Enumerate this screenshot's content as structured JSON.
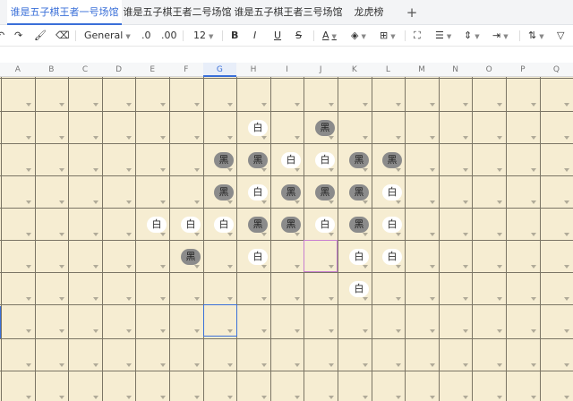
{
  "tabs": [
    {
      "label": "谁是五子棋王者一号场馆",
      "active": true
    },
    {
      "label": "谁是五子棋王者二号场馆",
      "active": false
    },
    {
      "label": "谁是五子棋王者三号场馆",
      "active": false
    },
    {
      "label": "龙虎榜",
      "active": false
    }
  ],
  "add_tab": "+",
  "toolbar": {
    "number_format": "General",
    "decrease_decimal": ".0",
    "increase_decimal": ".00",
    "font_size": "12",
    "bold": "B",
    "italic": "I",
    "underline": "U",
    "strike": "S",
    "font_color": "A"
  },
  "columns": [
    "A",
    "B",
    "C",
    "D",
    "E",
    "F",
    "G",
    "H",
    "I",
    "J",
    "K",
    "L",
    "M",
    "N",
    "O",
    "P",
    "Q"
  ],
  "selected_column": "G",
  "board": {
    "black_label": "黑",
    "white_label": "白",
    "stones": [
      {
        "col": "H",
        "row": 2,
        "color": "white"
      },
      {
        "col": "J",
        "row": 2,
        "color": "black"
      },
      {
        "col": "G",
        "row": 3,
        "color": "black"
      },
      {
        "col": "H",
        "row": 3,
        "color": "black"
      },
      {
        "col": "I",
        "row": 3,
        "color": "white"
      },
      {
        "col": "J",
        "row": 3,
        "color": "white"
      },
      {
        "col": "K",
        "row": 3,
        "color": "black"
      },
      {
        "col": "L",
        "row": 3,
        "color": "black"
      },
      {
        "col": "G",
        "row": 4,
        "color": "black"
      },
      {
        "col": "H",
        "row": 4,
        "color": "white"
      },
      {
        "col": "I",
        "row": 4,
        "color": "black"
      },
      {
        "col": "J",
        "row": 4,
        "color": "black"
      },
      {
        "col": "K",
        "row": 4,
        "color": "black"
      },
      {
        "col": "L",
        "row": 4,
        "color": "white"
      },
      {
        "col": "E",
        "row": 5,
        "color": "white"
      },
      {
        "col": "F",
        "row": 5,
        "color": "white"
      },
      {
        "col": "G",
        "row": 5,
        "color": "white"
      },
      {
        "col": "H",
        "row": 5,
        "color": "black"
      },
      {
        "col": "I",
        "row": 5,
        "color": "black"
      },
      {
        "col": "J",
        "row": 5,
        "color": "white"
      },
      {
        "col": "K",
        "row": 5,
        "color": "black"
      },
      {
        "col": "L",
        "row": 5,
        "color": "white"
      },
      {
        "col": "F",
        "row": 6,
        "color": "black"
      },
      {
        "col": "H",
        "row": 6,
        "color": "white"
      },
      {
        "col": "K",
        "row": 6,
        "color": "white"
      },
      {
        "col": "L",
        "row": 6,
        "color": "white"
      },
      {
        "col": "K",
        "row": 7,
        "color": "white"
      }
    ]
  },
  "colors": {
    "accent": "#3a6fd8",
    "board": "#f6edd2",
    "grid_line": "#7b7565",
    "black_stone": "#8b8b8b",
    "white_stone": "#ffffff",
    "cursor_cell": "#c77fd0"
  },
  "cursor_cell": {
    "col": "J",
    "row": 6
  },
  "selected_cell": {
    "col": "G",
    "row": 8
  }
}
